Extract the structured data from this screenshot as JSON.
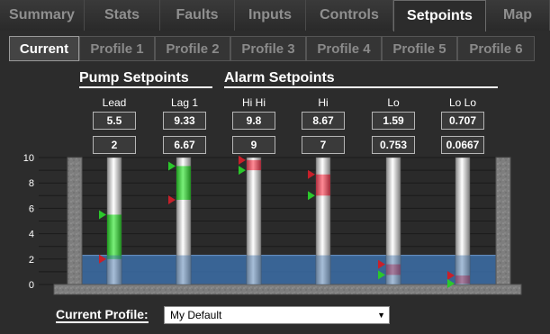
{
  "main_tabs": [
    {
      "label": "Summary",
      "active": false
    },
    {
      "label": "Stats",
      "active": false
    },
    {
      "label": "Faults",
      "active": false
    },
    {
      "label": "Inputs",
      "active": false
    },
    {
      "label": "Controls",
      "active": false
    },
    {
      "label": "Setpoints",
      "active": true
    },
    {
      "label": "Map",
      "active": false
    }
  ],
  "profile_tabs": [
    {
      "label": "Current",
      "active": true
    },
    {
      "label": "Profile 1",
      "active": false
    },
    {
      "label": "Profile 2",
      "active": false
    },
    {
      "label": "Profile 3",
      "active": false
    },
    {
      "label": "Profile 4",
      "active": false
    },
    {
      "label": "Profile 5",
      "active": false
    },
    {
      "label": "Profile 6",
      "active": false
    }
  ],
  "groups": {
    "pump": "Pump Setpoints",
    "alarm": "Alarm Setpoints"
  },
  "setpoints": [
    {
      "label": "Lead",
      "on": "5.5",
      "off": "2"
    },
    {
      "label": "Lag 1",
      "on": "9.33",
      "off": "6.67"
    },
    {
      "label": "Hi Hi",
      "on": "9.8",
      "off": "9"
    },
    {
      "label": "Hi",
      "on": "8.67",
      "off": "7"
    },
    {
      "label": "Lo",
      "on": "1.59",
      "off": "0.753"
    },
    {
      "label": "Lo Lo",
      "on": "0.707",
      "off": "0.0667"
    }
  ],
  "chart_data": {
    "type": "area",
    "y_ticks": [
      "10",
      "8",
      "6",
      "4",
      "2",
      "0"
    ],
    "ylim": [
      0,
      10
    ],
    "current_level": 2.3,
    "colors": {
      "pump_band": "#3ecf3e",
      "alarm_band": "#e86070",
      "on_marker": "#2bc82b",
      "off_marker": "#c8202a",
      "water": "#3c6ea8"
    }
  },
  "footer": {
    "label": "Current Profile:",
    "selected": "My Default"
  }
}
